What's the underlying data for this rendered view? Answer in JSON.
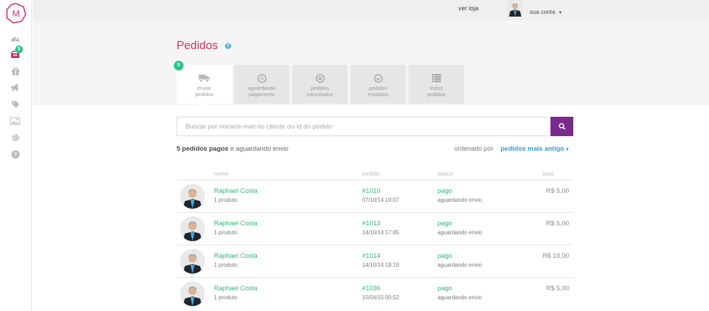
{
  "header": {
    "store_link": "ver loja",
    "account_label": "sua conta"
  },
  "sidebar": {
    "logo_letter": "M",
    "orders_badge": "5",
    "icons": [
      "dashboard-icon",
      "orders-icon",
      "gift-icon",
      "megaphone-icon",
      "tag-icon",
      "image-icon",
      "gear-icon",
      "help-icon"
    ]
  },
  "page": {
    "title": "Pedidos",
    "help": "?"
  },
  "tabs": [
    {
      "line1": "enviar",
      "line2": "pedidos",
      "icon": "truck-icon",
      "active": true
    },
    {
      "line1": "aguardando",
      "line2": "pagamento",
      "icon": "clock-icon",
      "active": false
    },
    {
      "line1": "pedidos",
      "line2": "cancelados",
      "icon": "cancel-circle-icon",
      "active": false
    },
    {
      "line1": "pedidos",
      "line2": "enviados",
      "icon": "check-circle-icon",
      "active": false
    },
    {
      "line1": "todos",
      "line2": "pedidos",
      "icon": "list-icon",
      "active": false
    }
  ],
  "tab_badge": "5",
  "search": {
    "placeholder": "Buscar por nome/e-mail do cliente ou id do pedido"
  },
  "summary": {
    "count_text": "5 pedidos pagos",
    "rest_text": " e aguardando envio",
    "sort_label": "ordenado por",
    "sort_value": "pedidos mais antigo"
  },
  "table": {
    "headers": {
      "name": "nome",
      "order": "pedido",
      "status": "status",
      "total": "total"
    },
    "rows": [
      {
        "name": "Raphael Costa",
        "products": "1 produto",
        "order": "#1010",
        "date": "07/10/14 19:07",
        "status": "pago",
        "substatus": "aguardando envio",
        "total": "R$ 5,00"
      },
      {
        "name": "Raphael Costa",
        "products": "1 produto",
        "order": "#1013",
        "date": "14/10/14 17:45",
        "status": "pago",
        "substatus": "aguardando envio",
        "total": "R$ 5,00"
      },
      {
        "name": "Raphael Costa",
        "products": "1 produto",
        "order": "#1014",
        "date": "14/10/14 18:19",
        "status": "pago",
        "substatus": "aguardando envio",
        "total": "R$ 19,00"
      },
      {
        "name": "Raphael Costa",
        "products": "1 produto",
        "order": "#1036",
        "date": "15/04/15 00:52",
        "status": "pago",
        "substatus": "aguardando envio",
        "total": "R$ 5,00"
      }
    ]
  },
  "colors": {
    "accent_pink": "#d0306b",
    "accent_green": "#2bb673",
    "search_button": "#7a2a8a",
    "sort_link": "#2a9fd6"
  }
}
